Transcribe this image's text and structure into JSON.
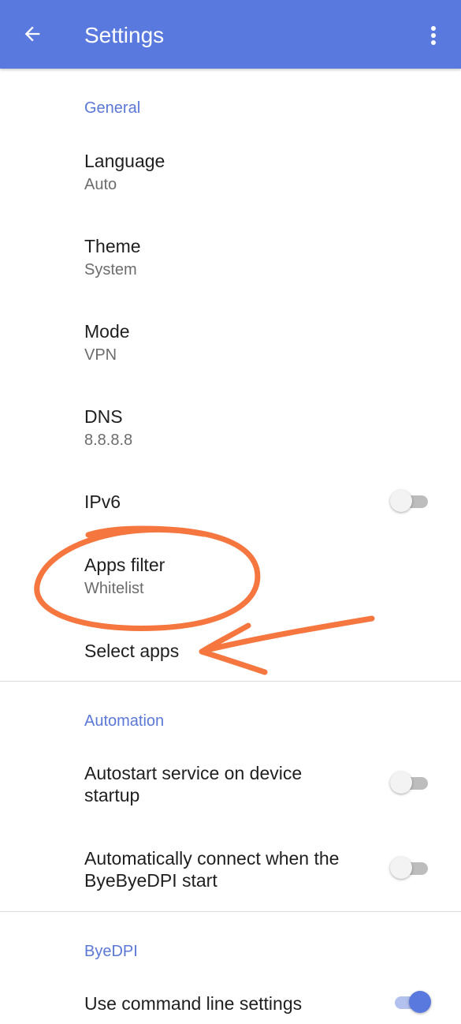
{
  "app_bar": {
    "title": "Settings",
    "back_icon": "arrow-left-icon",
    "menu_icon": "more-vert-icon",
    "background_color": "#5a79de"
  },
  "sections": {
    "general": {
      "header": "General",
      "language": {
        "title": "Language",
        "summary": "Auto"
      },
      "theme": {
        "title": "Theme",
        "summary": "System"
      },
      "mode": {
        "title": "Mode",
        "summary": "VPN"
      },
      "dns": {
        "title": "DNS",
        "summary": "8.8.8.8"
      },
      "ipv6": {
        "title": "IPv6",
        "enabled": false
      },
      "apps_filter": {
        "title": "Apps filter",
        "summary": "Whitelist"
      },
      "select_apps": {
        "title": "Select apps"
      }
    },
    "automation": {
      "header": "Automation",
      "autostart": {
        "title_line1": "Autostart service on device",
        "title_line2": "startup",
        "enabled": false
      },
      "auto_connect": {
        "title_line1": "Automatically connect when the",
        "title_line2": "ByeByeDPI start",
        "enabled": false
      }
    },
    "byedpi": {
      "header": "ByeDPI",
      "command_line": {
        "title": "Use command line settings",
        "enabled": true
      }
    }
  },
  "colors": {
    "accent": "#5b78d6",
    "annotation": "#f5763f"
  }
}
